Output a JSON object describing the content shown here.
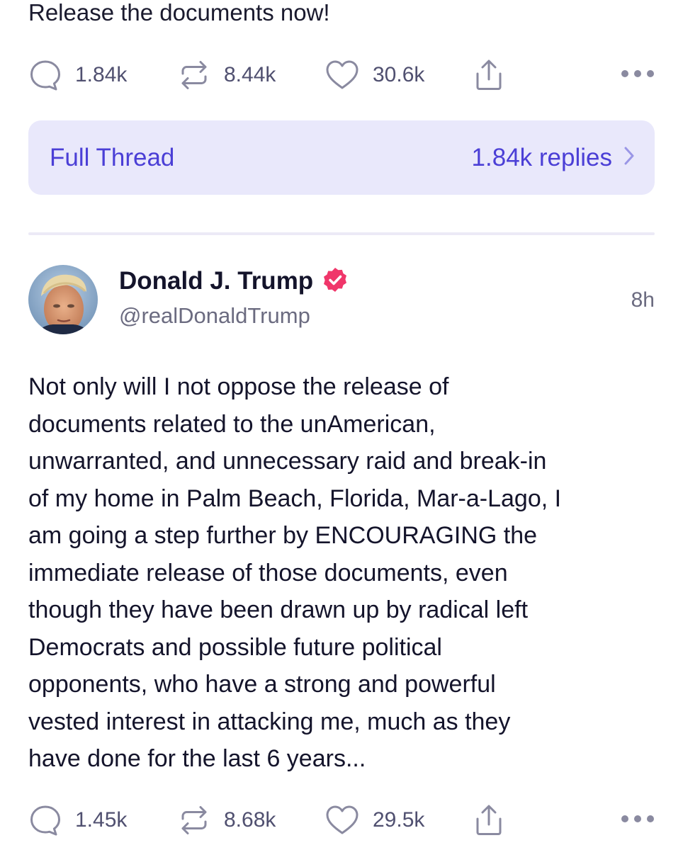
{
  "previous_post": {
    "text": "Release the documents now!",
    "actions": {
      "replies": "1.84k",
      "reposts": "8.44k",
      "likes": "30.6k"
    }
  },
  "full_thread": {
    "label": "Full Thread",
    "replies": "1.84k replies"
  },
  "post": {
    "author_name": "Donald J. Trump",
    "handle": "@realDonaldTrump",
    "time": "8h",
    "verified_color": "#f0366a",
    "text_lines": [
      "Not only will I not oppose the release of",
      "documents related to the unAmerican,",
      "unwarranted, and unnecessary raid and break-in",
      "of my home in Palm Beach, Florida, Mar-a-Lago, I",
      "am going a step further by ENCOURAGING the",
      "immediate release of those documents, even",
      "though they have been drawn up by radical left",
      "Democrats and possible future political",
      "opponents, who have a strong and powerful",
      "vested interest in attacking me, much as they",
      "have done for the last 6 years..."
    ],
    "actions": {
      "replies": "1.45k",
      "reposts": "8.68k",
      "likes": "29.5k"
    }
  },
  "colors": {
    "accent": "#4b3fd6",
    "thread_bg": "#e9e8fb",
    "icon_gray": "#8a8aa0"
  },
  "icons": [
    "reply-icon",
    "repost-icon",
    "like-icon",
    "share-icon",
    "more-icon",
    "chevron-right-icon",
    "verified-badge-icon"
  ]
}
